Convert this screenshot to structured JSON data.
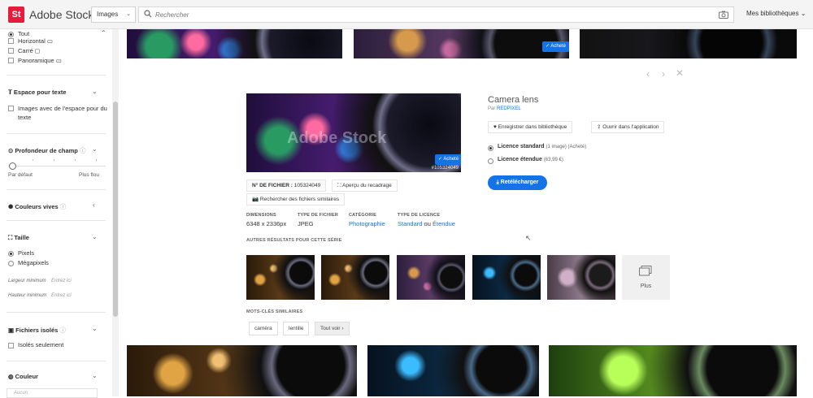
{
  "header": {
    "logo_text": "St",
    "brand": "Adobe Stock",
    "type_select": "Images",
    "search_placeholder": "Rechercher",
    "libraries": "Mes bibliothèques"
  },
  "sidebar": {
    "orientation": [
      "Tout",
      "Horizontal",
      "Carré",
      "Panoramique"
    ],
    "copy_space": {
      "title": "Espace pour texte",
      "option": "Images avec de l'espace pour du texte"
    },
    "depth": {
      "title": "Profondeur de champ",
      "min": "Par défaut",
      "max": "Plus flou"
    },
    "vivid": {
      "title": "Couleurs vives"
    },
    "size": {
      "title": "Taille",
      "options": [
        "Pixels",
        "Mégapixels"
      ],
      "min_width": "Largeur minimum",
      "min_height": "Hauteur minimum",
      "enter_here": "Entrez ici"
    },
    "isolated": {
      "title": "Fichiers isolés",
      "option": "Isolés seulement"
    },
    "color": {
      "title": "Couleur",
      "field_placeholder": "Aucun"
    }
  },
  "detail": {
    "badge_purchased": "Acheté",
    "watermark": "Adobe Stock",
    "image_id": "#105324049",
    "file_label": "N° DE FICHIER :",
    "file_number": "105324049",
    "crop_preview": "Aperçu du recadrage",
    "find_similar": "Rechercher des fichiers similaires",
    "meta": {
      "dimensions_h": "DIMENSIONS",
      "dimensions_v": "6348 x 2336px",
      "filetype_h": "TYPE DE FICHIER",
      "filetype_v": "JPEG",
      "category_h": "CATÉGORIE",
      "category_v": "Photographie",
      "license_h": "TYPE DE LICENCE",
      "license_standard": "Standard",
      "license_or": "ou",
      "license_extended": "Étendue"
    },
    "title": "Camera lens",
    "author_prefix": "Par",
    "author": "REDPIXEL",
    "save_to_library": "Enregistrer dans bibliothèque",
    "open_in_app": "Ouvrir dans l'application",
    "license_standard": "Licence standard",
    "license_standard_note": "(1 image) (Acheté)",
    "license_extended": "Licence étendue",
    "license_extended_price": "(63,99 €)",
    "redownload": "Retélécharger",
    "series_title": "AUTRES RÉSULTATS POUR CETTE SÉRIE",
    "more": "Plus",
    "keywords_title": "MOTS-CLÉS SIMILAIRES",
    "keywords": [
      "caméra",
      "lentille"
    ],
    "see_all": "Tout voir ›"
  }
}
